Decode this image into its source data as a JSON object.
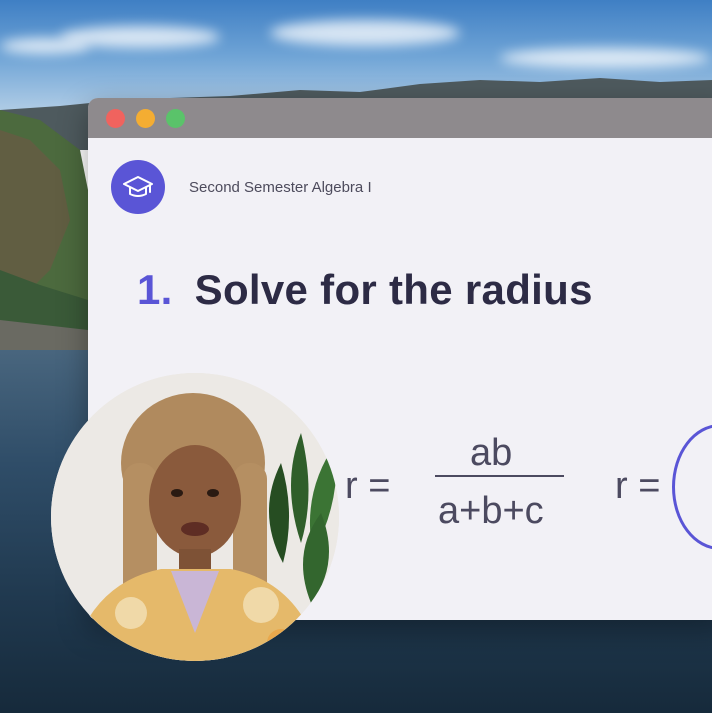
{
  "window": {
    "controls": [
      "close",
      "minimize",
      "maximize"
    ]
  },
  "course": {
    "icon": "graduation-cap-icon",
    "title": "Second Semester Algebra I"
  },
  "question": {
    "number": "1.",
    "text": "Solve for the radius"
  },
  "equation": {
    "lhs": "r =",
    "numerator": "ab",
    "denominator": "a+b+c",
    "second_lhs": "r ="
  },
  "colors": {
    "accent": "#5a55d6",
    "heading": "#2d2b45",
    "body_text": "#4c4a60"
  },
  "webcam": {
    "icon": "presenter-video"
  }
}
